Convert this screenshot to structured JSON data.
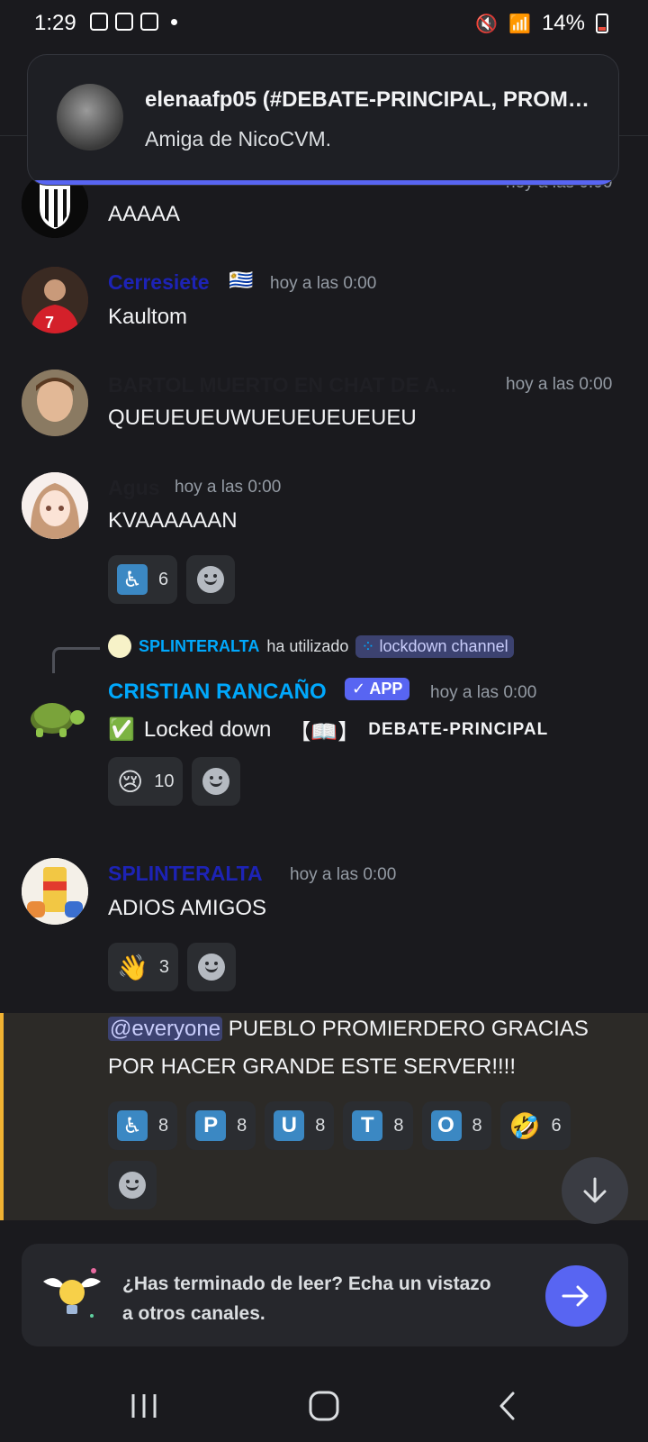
{
  "status": {
    "time": "1:29",
    "battery": "14%"
  },
  "notification": {
    "title": "elenaafp05 (#DEBATE-PRINCIPAL, PROM…",
    "body": "Amiga de NicoCVM."
  },
  "messages": [
    {
      "id": "m0",
      "username": "",
      "time": "hoy a las 0:00",
      "text": "AAAAA"
    },
    {
      "id": "m1",
      "username": "Cerresiete",
      "flag": "🇺🇾",
      "time": "hoy a las 0:00",
      "text": "Kaultom"
    },
    {
      "id": "m2",
      "username": "BARTOL MUERTO EN CHAT DE A...",
      "time": "hoy a las 0:00",
      "text": "QUEUEUEUWUEUEUEUEUEU"
    },
    {
      "id": "m3",
      "username": "Agus",
      "time": "hoy a las 0:00",
      "text": "KVAAAAAAN",
      "reactions": [
        {
          "emoji": "wheelchair",
          "count": "6"
        }
      ]
    },
    {
      "id": "m4",
      "command_user": "SPLINTERALTA",
      "command_verb": "ha utilizado",
      "command_name": "lockdown channel",
      "username": "CRISTIAN RANCAÑO",
      "badge": "✓ APP",
      "time": "hoy a las 0:00",
      "text_check": "✅",
      "text": "Locked down",
      "text_book": "【📖】",
      "text_channel": "DEBATE-PRINCIPAL",
      "reactions": [
        {
          "emoji": "😢",
          "count": "10"
        }
      ]
    },
    {
      "id": "m5",
      "username": "SPLINTERALTA",
      "time": "hoy a las 0:00",
      "text": "ADIOS AMIGOS",
      "reactions": [
        {
          "emoji": "👋",
          "count": "3"
        }
      ]
    },
    {
      "id": "m6",
      "mention": "@everyone",
      "text_line1": "PUEBLO PROMIERDERO GRACIAS",
      "text_line2": "POR HACER GRANDE ESTE SERVER!!!!",
      "reactions": [
        {
          "emoji": "wheelchair",
          "count": "8"
        },
        {
          "emoji": "P",
          "count": "8"
        },
        {
          "emoji": "U",
          "count": "8"
        },
        {
          "emoji": "T",
          "count": "8"
        },
        {
          "emoji": "O",
          "count": "8"
        },
        {
          "emoji": "🤣",
          "count": "6"
        }
      ]
    }
  ],
  "footer": {
    "text": "¿Has terminado de leer? Echa un vistazo a otros canales."
  },
  "colors": {
    "accent": "#5865f2",
    "mention_bar": "#f0b232",
    "blurple_name": "#00a8fc"
  }
}
